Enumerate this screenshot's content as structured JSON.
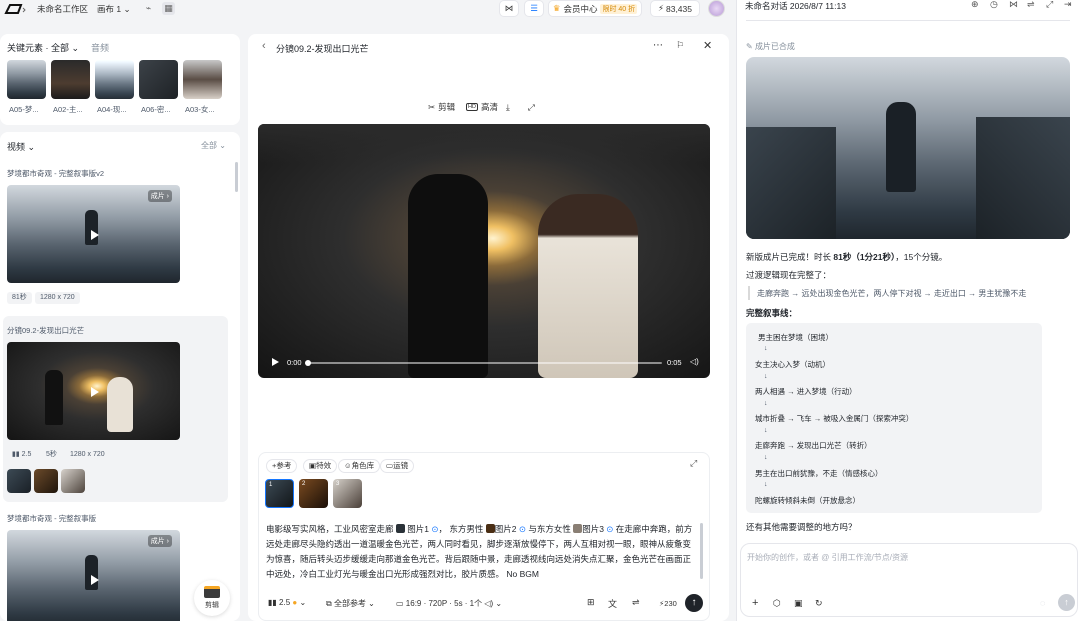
{
  "topbar": {
    "workspace": "未命名工作区",
    "canvas": "画布 1",
    "member_label": "会员中心",
    "member_badge": "限时 40 折",
    "credits": "83,435"
  },
  "assets": {
    "title": "关键元素 · 全部",
    "tab_audio": "音频",
    "items": [
      "A05-梦...",
      "A02-主...",
      "A04-现...",
      "A06-密...",
      "A03-女..."
    ]
  },
  "videos": {
    "title": "视频",
    "filter": "全部",
    "groups": [
      {
        "title": "梦境都市奇观 - 完整叙事版v2",
        "badge": "成片",
        "duration": "81秒",
        "resolution": "1280 x 720"
      },
      {
        "title": "分镜09.2-发现出口光芒",
        "stat": "2.5",
        "duration": "5秒",
        "resolution": "1280 x 720"
      },
      {
        "title": "梦境都市奇观 - 完整叙事版",
        "badge": "成片"
      }
    ],
    "edit_label": "剪辑"
  },
  "center": {
    "title": "分镜09.2-发现出口光芒",
    "tools": {
      "cut": "剪辑",
      "hd": "高清"
    },
    "player": {
      "current": "0:00",
      "total": "0:05"
    },
    "chips": [
      "+参考",
      "特效",
      "角色库",
      "运镜"
    ],
    "prompt": {
      "p1": "电影级写实风格，工业风密室走廊 ",
      "img1": "图片1",
      "p2": "， 东方男性 ",
      "img2": "图片2",
      "p3": " 与东方女性 ",
      "img3": "图片3",
      "p4": " 在走廊中奔跑，前方远处走廊尽头隐约透出一道温暖金色光芒，两人同时看见，脚步逐渐放慢停下，两人互相对视一眼，眼神从疲惫变为惊喜，随后转头迈步缓缓走向那道金色光芒。背后跟随中景，走廊透视线向远处消失点汇聚，金色光芒在画面正中远处，冷白工业灯光与暖金出口光形成强烈对比，胶片质感。 No BGM"
    },
    "footer": {
      "stat": "2.5",
      "ref_mode": "全部参考",
      "settings": "16:9 · 720P · 5s · 1个",
      "credits": "230"
    }
  },
  "right": {
    "title": "未命名对话 2026/8/7 11:13",
    "status": "成片已合成",
    "msg1_pre": "新版成片已完成！时长 ",
    "msg1_bold": "81秒（1分21秒）",
    "msg1_post": "，15个分镜。",
    "msg2": "过渡逻辑现在完整了：",
    "quote": "走廊奔跑 → 远处出现金色光芒，两人停下对视 → 走近出口 → 男主犹豫不走",
    "flow_title": "完整叙事线：",
    "flow": [
      "男主困在梦境（困境）",
      "女主决心入梦（动机）",
      "两人相遇 → 进入梦境（行动）",
      "城市折叠 → 飞车 → 被吸入金属门（探索冲突）",
      "走廊奔跑 → 发现出口光芒（转折）",
      "男主在出口前犹豫，不走（情感核心）",
      "陀螺旋转倾斜未倒（开放悬念）"
    ],
    "arrow": "↓",
    "question": "还有其他需要调整的地方吗？",
    "input_placeholder": "开始你的创作，或者 @ 引用工作流/节点/资源"
  },
  "colors": {
    "accent": "#1f2329",
    "gold": "#f5a623",
    "member_bg": "#fff7e6"
  }
}
